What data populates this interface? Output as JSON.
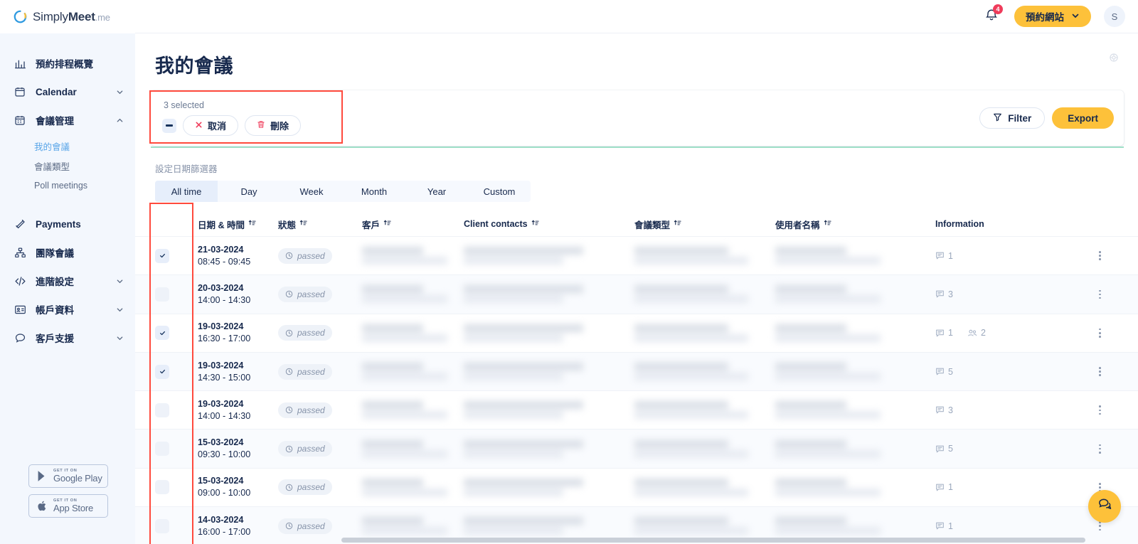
{
  "brand": {
    "name_light": "Simply",
    "name_bold": "Meet",
    "suffix": ".me",
    "logo_icon": "simplymeet-ring-logo",
    "accent_yellow": "#fdc13a",
    "accent_blue": "#2f9ae0",
    "text_navy": "#17294d",
    "danger_red": "#ef3c5b"
  },
  "topbar": {
    "notifications_icon": "bell-icon",
    "notifications_count": "4",
    "booking_site_label": "預約網站",
    "booking_site_chevron": "chevron-down-icon",
    "avatar_initial": "S"
  },
  "sidebar": {
    "items": [
      {
        "label": "預約排程概覽",
        "icon": "bar-chart-icon",
        "chevron": false
      },
      {
        "label": "Calendar",
        "icon": "calendar-icon",
        "chevron": true,
        "expanded": false
      },
      {
        "label": "會議管理",
        "icon": "calendar-days-icon",
        "chevron": true,
        "expanded": true,
        "children": [
          {
            "label": "我的會議",
            "active": true
          },
          {
            "label": "會議類型",
            "active": false
          },
          {
            "label": "Poll meetings",
            "active": false
          }
        ]
      },
      {
        "label": "Payments",
        "icon": "payments-icon",
        "chevron": false
      },
      {
        "label": "團隊會議",
        "icon": "org-tree-icon",
        "chevron": false
      },
      {
        "label": "進階設定",
        "icon": "code-icon",
        "chevron": true,
        "expanded": false
      },
      {
        "label": "帳戶資料",
        "icon": "id-card-icon",
        "chevron": true,
        "expanded": false
      },
      {
        "label": "客戶支援",
        "icon": "chat-bubble-icon",
        "chevron": true,
        "expanded": false
      }
    ],
    "store_badges": [
      {
        "small": "GET IT ON",
        "big": "Google Play",
        "icon": "google-play-icon"
      },
      {
        "small": "GET IT ON",
        "big": "App Store",
        "icon": "apple-icon"
      }
    ]
  },
  "page": {
    "title": "我的會議",
    "settings_icon": "gear-icon"
  },
  "selection_bar": {
    "count_label": "3 selected",
    "master_checkbox_state": "indeterminate",
    "cancel_label": "取消",
    "cancel_icon": "close-x-icon",
    "delete_label": "刪除",
    "delete_icon": "trash-icon",
    "filter_label": "Filter",
    "filter_icon": "funnel-icon",
    "export_label": "Export"
  },
  "date_filter": {
    "label": "設定日期篩選器",
    "tabs": [
      {
        "label": "All time",
        "active": true
      },
      {
        "label": "Day",
        "active": false
      },
      {
        "label": "Week",
        "active": false
      },
      {
        "label": "Month",
        "active": false
      },
      {
        "label": "Year",
        "active": false
      },
      {
        "label": "Custom",
        "active": false
      }
    ]
  },
  "table": {
    "columns": [
      {
        "label": "",
        "sortable": false,
        "key": "checkbox"
      },
      {
        "label": "日期 & 時間",
        "sortable": true,
        "sort_icon": "sort-icon",
        "key": "datetime"
      },
      {
        "label": "狀態",
        "sortable": true,
        "sort_icon": "sort-icon",
        "key": "status"
      },
      {
        "label": "客戶",
        "sortable": true,
        "sort_icon": "sort-icon",
        "key": "client"
      },
      {
        "label": "Client contacts",
        "sortable": true,
        "sort_icon": "sort-icon",
        "key": "contacts"
      },
      {
        "label": "會議類型",
        "sortable": true,
        "sort_icon": "sort-icon",
        "key": "meeting_type"
      },
      {
        "label": "使用者名稱",
        "sortable": true,
        "sort_icon": "sort-icon",
        "key": "username"
      },
      {
        "label": "Information",
        "sortable": false,
        "key": "information"
      }
    ],
    "rows": [
      {
        "checked": true,
        "date": "21-03-2024",
        "time": "08:45 - 09:45",
        "status": "passed",
        "status_icon": "clock-icon",
        "comments": "1",
        "attendees": null,
        "menu_icon": "kebab-menu-icon",
        "redacted": true
      },
      {
        "checked": false,
        "date": "20-03-2024",
        "time": "14:00 - 14:30",
        "status": "passed",
        "status_icon": "clock-icon",
        "comments": "3",
        "attendees": null,
        "menu_icon": "kebab-menu-icon",
        "redacted": true
      },
      {
        "checked": true,
        "date": "19-03-2024",
        "time": "16:30 - 17:00",
        "status": "passed",
        "status_icon": "clock-icon",
        "comments": "1",
        "attendees": "2",
        "menu_icon": "kebab-menu-icon",
        "redacted": true
      },
      {
        "checked": true,
        "date": "19-03-2024",
        "time": "14:30 - 15:00",
        "status": "passed",
        "status_icon": "clock-icon",
        "comments": "5",
        "attendees": null,
        "menu_icon": "kebab-menu-icon",
        "redacted": true
      },
      {
        "checked": false,
        "date": "19-03-2024",
        "time": "14:00 - 14:30",
        "status": "passed",
        "status_icon": "clock-icon",
        "comments": "3",
        "attendees": null,
        "menu_icon": "kebab-menu-icon",
        "redacted": true
      },
      {
        "checked": false,
        "date": "15-03-2024",
        "time": "09:30 - 10:00",
        "status": "passed",
        "status_icon": "clock-icon",
        "comments": "5",
        "attendees": null,
        "menu_icon": "kebab-menu-icon",
        "redacted": true
      },
      {
        "checked": false,
        "date": "15-03-2024",
        "time": "09:00 - 10:00",
        "status": "passed",
        "status_icon": "clock-icon",
        "comments": "1",
        "attendees": null,
        "menu_icon": "kebab-menu-icon",
        "redacted": true
      },
      {
        "checked": false,
        "date": "14-03-2024",
        "time": "16:00 - 17:00",
        "status": "passed",
        "status_icon": "clock-icon",
        "comments": "1",
        "attendees": null,
        "menu_icon": "kebab-menu-icon",
        "redacted": true
      }
    ]
  },
  "chat_widget": {
    "icon": "chat-bubbles-icon"
  }
}
